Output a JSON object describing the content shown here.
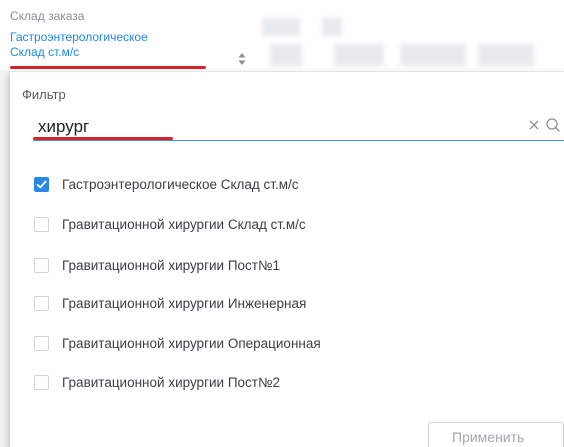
{
  "field": {
    "caption": "Склад заказа",
    "value_line1": "Гастроэнтерологическое",
    "value_line2": "Склад ст.м/с"
  },
  "filter": {
    "label": "Фильтр",
    "value": "хирург"
  },
  "options": [
    {
      "label": "Гастроэнтерологическое Склад ст.м/с",
      "checked": true
    },
    {
      "label": "Гравитационной хирургии Склад ст.м/с",
      "checked": false
    },
    {
      "label": "Гравитационной хирургии Пост№1",
      "checked": false
    },
    {
      "label": "Гравитационной хирургии Инженерная",
      "checked": false
    },
    {
      "label": "Гравитационной хирургии Операционная",
      "checked": false
    },
    {
      "label": "Гравитационной хирургии Пост№2",
      "checked": false
    }
  ],
  "apply_label": "Применить",
  "colors": {
    "accent": "#2a86e5",
    "link": "#1e88e5",
    "annotation_red": "#d8232a"
  },
  "icons": {
    "sort": "sort-arrows-icon",
    "clear": "close-icon",
    "search": "search-icon",
    "check": "checkmark-icon"
  }
}
